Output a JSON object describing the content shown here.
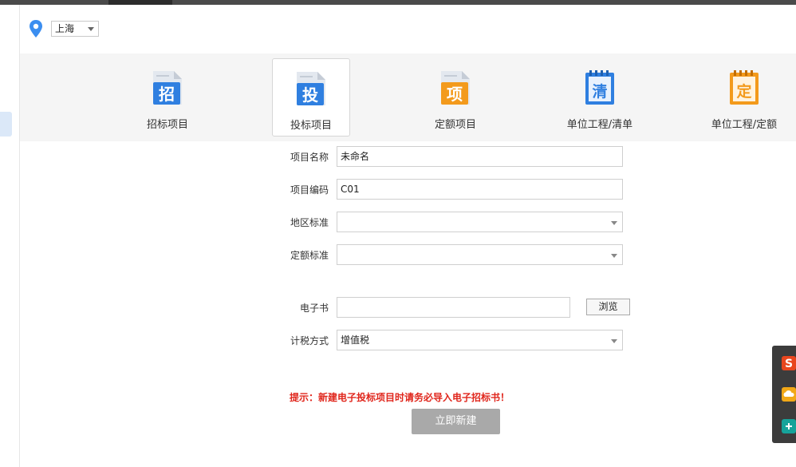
{
  "location": {
    "city": "上海"
  },
  "project_types": [
    {
      "glyph": "招",
      "label": "招标项目",
      "color": "#2f7fe0",
      "selected": false
    },
    {
      "glyph": "投",
      "label": "投标项目",
      "color": "#2f7fe0",
      "selected": true
    },
    {
      "glyph": "项",
      "label": "定额项目",
      "color": "#f39a1c",
      "selected": false
    },
    {
      "glyph": "清",
      "label": "单位工程/清单",
      "color": "#2f7fe0",
      "selected": false
    },
    {
      "glyph": "定",
      "label": "单位工程/定额",
      "color": "#f39a1c",
      "selected": false
    }
  ],
  "form": {
    "project_name": {
      "label": "项目名称",
      "value": "未命名"
    },
    "project_code": {
      "label": "项目编码",
      "value": "C01"
    },
    "region_standard": {
      "label": "地区标准",
      "value": ""
    },
    "quota_standard": {
      "label": "定额标准",
      "value": ""
    },
    "ebook": {
      "label": "电子书",
      "value": "",
      "browse_label": "浏览"
    },
    "tax_method": {
      "label": "计税方式",
      "value": "增值税"
    }
  },
  "hint": "提示：新建电子投标项目时请务必导入电子招标书！",
  "create_button": "立即新建",
  "colors": {
    "accent_blue": "#2f7fe0",
    "accent_orange": "#f39a1c",
    "hint_red": "#e0261c",
    "button_disabled": "#a9a9a9"
  }
}
